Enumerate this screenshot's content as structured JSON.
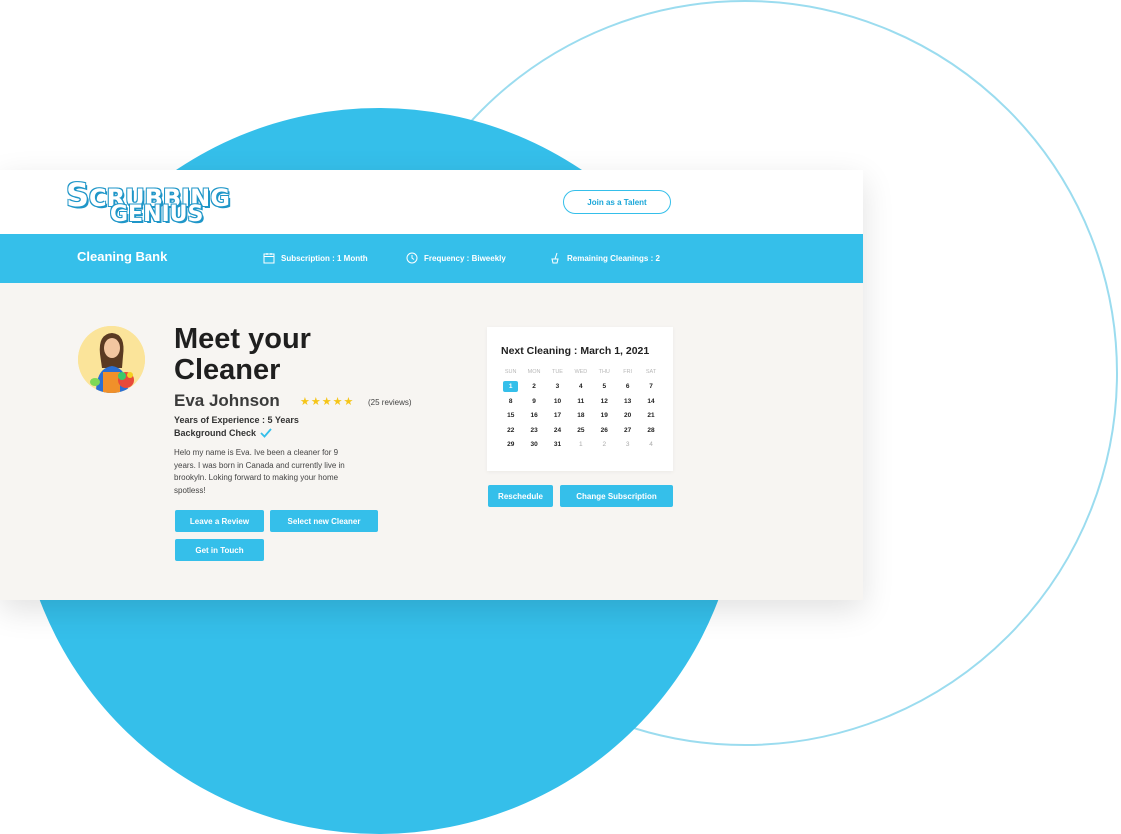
{
  "logo": {
    "line1_cap": "S",
    "line1_rest": "CRUBBING",
    "line2": "GENIUS"
  },
  "header": {
    "join_label": "Join as a Talent"
  },
  "bank_bar": {
    "title": "Cleaning Bank",
    "subscription": "Subscription : 1 Month",
    "frequency": "Frequency : Biweekly",
    "remaining": "Remaining Cleanings : 2"
  },
  "cleaner": {
    "heading_line1": "Meet your",
    "heading_line2": "Cleaner",
    "name": "Eva Johnson",
    "stars": "★★★★★",
    "rating": 5,
    "reviews": "(25 reviews)",
    "experience": "Years of Experience : 5 Years",
    "background_check": "Background Check",
    "bio": "Helo my name is Eva. Ive been a cleaner for 9 years. I was born in Canada and currently live in brookyln. Loking forward to making your home spotless!"
  },
  "actions": {
    "leave_review": "Leave a Review",
    "select_cleaner": "Select new Cleaner",
    "get_in_touch": "Get in Touch",
    "reschedule": "Reschedule",
    "change_subscription": "Change Subscription"
  },
  "calendar": {
    "title": "Next Cleaning : March 1, 2021",
    "weekdays": [
      "SUN",
      "MON",
      "TUE",
      "WED",
      "THU",
      "FRI",
      "SAT"
    ],
    "selected_day": "1",
    "weeks": [
      [
        "1",
        "2",
        "3",
        "4",
        "5",
        "6",
        "7"
      ],
      [
        "8",
        "9",
        "10",
        "11",
        "12",
        "13",
        "14"
      ],
      [
        "15",
        "16",
        "17",
        "18",
        "19",
        "20",
        "21"
      ],
      [
        "22",
        "23",
        "24",
        "25",
        "26",
        "27",
        "28"
      ],
      [
        "29",
        "30",
        "31",
        "1",
        "2",
        "3",
        "4"
      ]
    ],
    "muted_from_index_in_last_week": 3
  },
  "colors": {
    "accent": "#35bfea",
    "card_bg": "#f7f5f2",
    "star": "#f5c518"
  },
  "icons": {
    "subscription": "calendar-icon",
    "frequency": "clock-icon",
    "remaining": "cleaning-brush-icon",
    "background_check": "checkmark-icon"
  }
}
